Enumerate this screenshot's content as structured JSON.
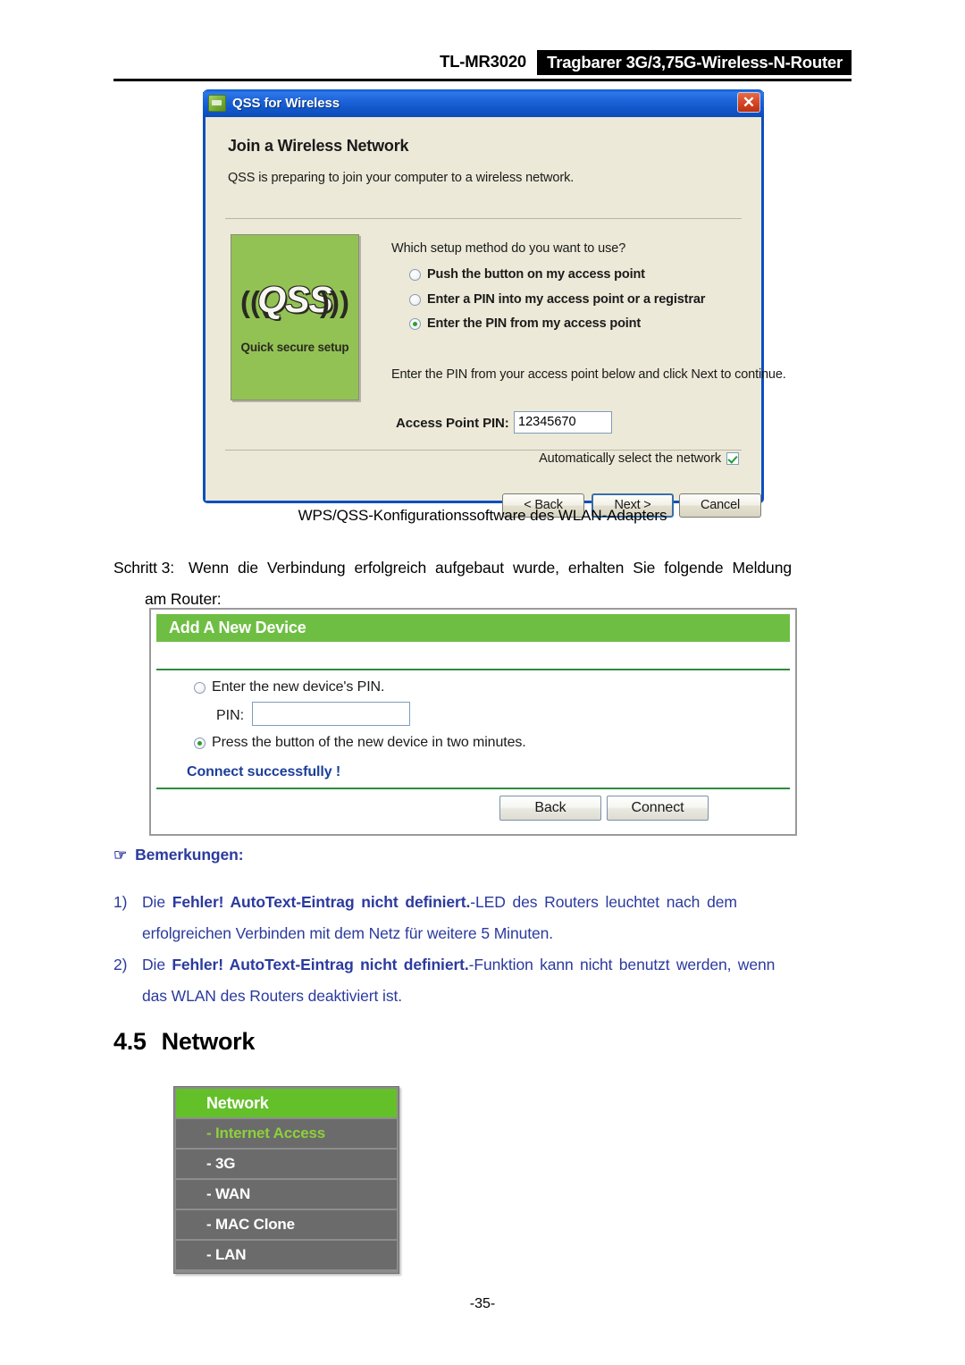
{
  "header": {
    "model": "TL-MR3020",
    "banner": "Tragbarer 3G/3,75G-Wireless-N-Router"
  },
  "qss_dialog": {
    "title": "QSS for Wireless",
    "title_icon": "qss-app-icon",
    "close_label": "✕",
    "heading": "Join a Wireless Network",
    "subtitle": "QSS is preparing to join your computer to a wireless network.",
    "logo": {
      "mark": "QSS",
      "wave_left": "((( ",
      "wave_right": " )))",
      "caption": "Quick secure setup",
      "background_color": "#93c254"
    },
    "question": "Which setup method do you want to use?",
    "options": [
      {
        "label": "Push the button on my access point",
        "selected": false
      },
      {
        "label": "Enter a PIN into my access point or a registrar",
        "selected": false
      },
      {
        "label": "Enter the PIN from my access point",
        "selected": true
      }
    ],
    "hint": "Enter the PIN from your access point below and click Next to continue.",
    "pin_label": "Access Point PIN:",
    "pin_value": "12345670",
    "auto_select_label": "Automatically select the network",
    "auto_select_checked": true,
    "buttons": {
      "back": "< Back",
      "next": "Next >",
      "cancel": "Cancel"
    }
  },
  "caption": "WPS/QSS-Konfigurationssoftware des WLAN-Adapters",
  "step": {
    "label": "Schritt 3:",
    "line1": "Wenn die Verbindung erfolgreich aufgebaut wurde, erhalten Sie folgende Meldung",
    "line2": "am Router:"
  },
  "add_new_device": {
    "title": "Add A New Device",
    "option_pin": "Enter the new device's PIN.",
    "option_pin_selected": false,
    "pin_label": "PIN:",
    "pin_value": "",
    "option_button": "Press the button of the new device in two minutes.",
    "option_button_selected": true,
    "status": "Connect successfully !",
    "status_color": "#1b3f99",
    "buttons": {
      "back": "Back",
      "connect": "Connect"
    },
    "header_color": "#6fbe44"
  },
  "notes": {
    "heading": "Bemerkungen:",
    "hand_icon": "pointing-hand-icon",
    "items": [
      {
        "number": "1)",
        "prefix": "Die ",
        "bold": "Fehler! AutoText-Eintrag nicht definiert.",
        "suffix": "-LED des Routers leuchtet nach dem",
        "continuation": "erfolgreichen Verbinden mit dem Netz für weitere 5 Minuten."
      },
      {
        "number": "2)",
        "prefix": "Die ",
        "bold": "Fehler! AutoText-Eintrag nicht definiert.",
        "suffix": "-Funktion kann nicht benutzt werden, wenn",
        "continuation": "das WLAN des Routers deaktiviert ist."
      }
    ]
  },
  "section": {
    "number": "4.5",
    "title": "Network"
  },
  "network_menu": {
    "header": "Network",
    "header_color": "#63c029",
    "active_color": "#8dd13a",
    "items": [
      {
        "label": "- Internet Access",
        "active": true
      },
      {
        "label": "- 3G",
        "active": false
      },
      {
        "label": "- WAN",
        "active": false
      },
      {
        "label": "- MAC Clone",
        "active": false
      },
      {
        "label": "- LAN",
        "active": false
      }
    ]
  },
  "footer": {
    "page": "-35-"
  }
}
